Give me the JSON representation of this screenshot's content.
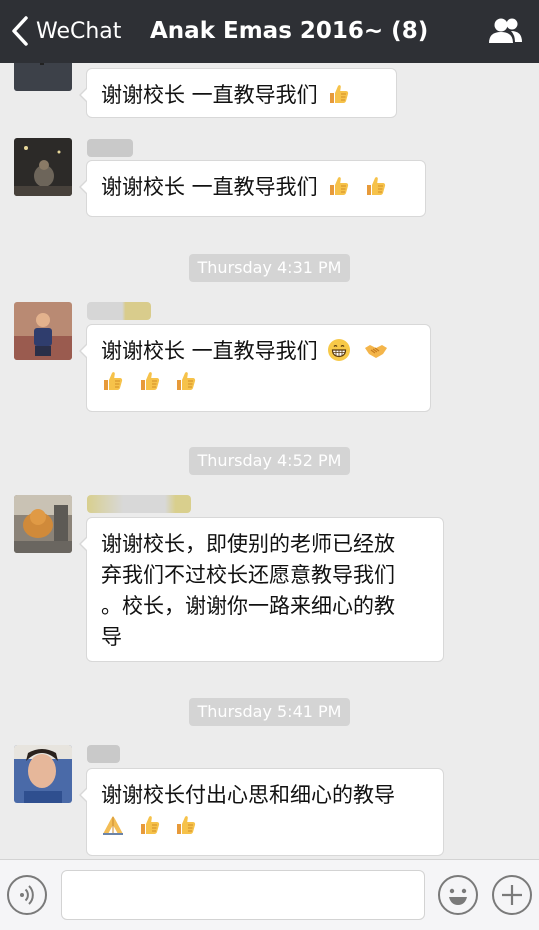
{
  "nav": {
    "back_label": "WeChat",
    "title": "Anak Emas 2016~ (8)"
  },
  "messages": [
    {
      "text": "谢谢校长 一直教导我们",
      "emojis": [
        "thumbs-up-emoji"
      ]
    },
    {
      "text": "谢谢校长 一直教导我们",
      "emojis": [
        "thumbs-up-emoji",
        "thumbs-up-emoji"
      ]
    },
    {
      "timestamp": "Thursday 4:31 PM",
      "text": "谢谢校长 一直教导我们",
      "emojis": [
        "grin-emoji",
        "handshake-emoji",
        "thumbs-up-emoji",
        "thumbs-up-emoji",
        "thumbs-up-emoji"
      ]
    },
    {
      "timestamp": "Thursday 4:52 PM",
      "text_lines": [
        "谢谢校长，即使别的老师已经放",
        "弃我们不过校长还愿意教导我们",
        "。校长，谢谢你一路来细心的教",
        "导"
      ]
    },
    {
      "timestamp": "Thursday 5:41 PM",
      "text": "谢谢校长付出心思和细心的教导",
      "emojis": [
        "praying-hands-emoji",
        "thumbs-up-emoji",
        "thumbs-up-emoji"
      ]
    }
  ],
  "input_bar": {
    "voice_icon": "voice-icon",
    "emoji_icon": "sticker-icon",
    "add_icon": "plus-icon"
  },
  "colors": {
    "nav_bg": "#2e3035",
    "chat_bg": "#ececec",
    "bubble_bg": "#ffffff",
    "timestamp_bg": "#d4d4d4"
  }
}
